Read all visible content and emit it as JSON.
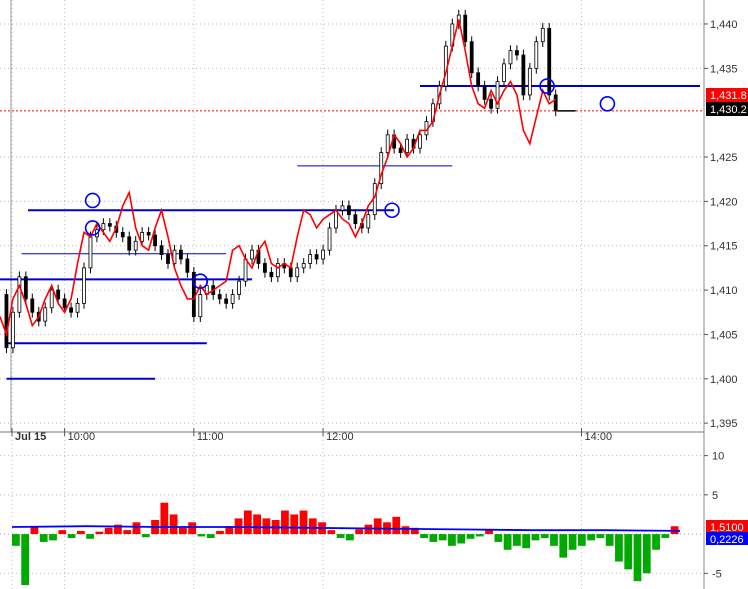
{
  "chart_data": [
    {
      "type": "candlestick",
      "title": "",
      "x_ticks": [
        {
          "label": "Jul 15",
          "time": "09:30"
        },
        {
          "label": "10:00",
          "time": "10:00"
        },
        {
          "label": "11:00",
          "time": "11:00"
        },
        {
          "label": "12:00",
          "time": "12:00"
        },
        {
          "label": "14:00",
          "time": "14:00"
        }
      ],
      "x_range": [
        "09:30",
        "14:55"
      ],
      "y_ticks": [
        "1,440",
        "1,435",
        "1,425",
        "1,420",
        "1,415",
        "1,410",
        "1,405",
        "1,400",
        "1,395"
      ],
      "ylim": [
        1394,
        1441.8
      ],
      "grid": true,
      "price_series": {
        "name": "",
        "points": [
          [
            "09:30",
            1409.5
          ],
          [
            "09:33",
            1403.5
          ],
          [
            "09:36",
            1407.5
          ],
          [
            "09:39",
            1411.5
          ],
          [
            "09:42",
            1409.0
          ],
          [
            "09:45",
            1407.5
          ],
          [
            "09:48",
            1406.5
          ],
          [
            "09:51",
            1408.0
          ],
          [
            "09:54",
            1410.0
          ],
          [
            "09:57",
            1409.0
          ],
          [
            "10:00",
            1408.0
          ],
          [
            "10:03",
            1407.5
          ],
          [
            "10:06",
            1408.5
          ],
          [
            "10:09",
            1412.5
          ],
          [
            "10:12",
            1416.0
          ],
          [
            "10:15",
            1416.8
          ],
          [
            "10:18",
            1417.5
          ],
          [
            "10:21",
            1417.2
          ],
          [
            "10:24",
            1416.5
          ],
          [
            "10:27",
            1416.0
          ],
          [
            "10:30",
            1414.5
          ],
          [
            "10:33",
            1415.5
          ],
          [
            "10:36",
            1416.5
          ],
          [
            "10:39",
            1416.2
          ],
          [
            "10:42",
            1415.0
          ],
          [
            "10:45",
            1414.0
          ],
          [
            "10:48",
            1413.0
          ],
          [
            "10:51",
            1414.5
          ],
          [
            "10:54",
            1413.5
          ],
          [
            "10:57",
            1412.0
          ],
          [
            "11:00",
            1407.0
          ],
          [
            "11:03",
            1409.5
          ],
          [
            "11:06",
            1410.5
          ],
          [
            "11:09",
            1409.5
          ],
          [
            "11:12",
            1409.0
          ],
          [
            "11:15",
            1408.5
          ],
          [
            "11:18",
            1409.5
          ],
          [
            "11:21",
            1411.0
          ],
          [
            "11:24",
            1413.5
          ],
          [
            "11:27",
            1414.5
          ],
          [
            "11:30",
            1413.0
          ],
          [
            "11:33",
            1412.0
          ],
          [
            "11:36",
            1411.5
          ],
          [
            "11:39",
            1413.0
          ],
          [
            "11:42",
            1412.5
          ],
          [
            "11:45",
            1411.5
          ],
          [
            "11:48",
            1412.5
          ],
          [
            "11:51",
            1413.0
          ],
          [
            "11:54",
            1414.0
          ],
          [
            "11:57",
            1413.5
          ],
          [
            "12:00",
            1414.5
          ],
          [
            "12:03",
            1417.0
          ],
          [
            "12:06",
            1419.0
          ],
          [
            "12:09",
            1419.5
          ],
          [
            "12:12",
            1418.5
          ],
          [
            "12:15",
            1417.5
          ],
          [
            "12:18",
            1417.0
          ],
          [
            "12:21",
            1418.5
          ],
          [
            "12:24",
            1422.0
          ],
          [
            "12:27",
            1425.5
          ],
          [
            "12:30",
            1427.5
          ],
          [
            "12:33",
            1426.0
          ],
          [
            "12:36",
            1425.5
          ],
          [
            "12:39",
            1427.0
          ],
          [
            "12:42",
            1426.0
          ],
          [
            "12:45",
            1427.5
          ],
          [
            "12:48",
            1429.0
          ],
          [
            "12:51",
            1431.0
          ],
          [
            "12:54",
            1433.0
          ],
          [
            "12:57",
            1437.5
          ],
          [
            "13:00",
            1440.0
          ],
          [
            "13:03",
            1441.0
          ],
          [
            "13:06",
            1438.0
          ],
          [
            "13:09",
            1434.5
          ],
          [
            "13:12",
            1433.0
          ],
          [
            "13:15",
            1431.5
          ],
          [
            "13:18",
            1430.5
          ],
          [
            "13:21",
            1433.5
          ],
          [
            "13:24",
            1435.5
          ],
          [
            "13:27",
            1437.0
          ],
          [
            "13:30",
            1436.5
          ],
          [
            "13:33",
            1432.0
          ],
          [
            "13:36",
            1435.0
          ],
          [
            "13:39",
            1438.0
          ],
          [
            "13:42",
            1439.5
          ],
          [
            "13:45",
            1432.0
          ],
          [
            "13:48",
            1430.2
          ]
        ]
      },
      "overlay_series": {
        "name": "",
        "color": "#ff0000",
        "points": [
          [
            "09:30",
            1407.0
          ],
          [
            "09:33",
            1405.0
          ],
          [
            "09:36",
            1409.0
          ],
          [
            "09:39",
            1410.5
          ],
          [
            "09:42",
            1408.5
          ],
          [
            "09:45",
            1406.0
          ],
          [
            "09:48",
            1407.0
          ],
          [
            "09:51",
            1409.0
          ],
          [
            "09:54",
            1410.5
          ],
          [
            "09:57",
            1408.5
          ],
          [
            "10:00",
            1407.5
          ],
          [
            "10:03",
            1409.0
          ],
          [
            "10:06",
            1413.0
          ],
          [
            "10:09",
            1416.5
          ],
          [
            "10:12",
            1416.0
          ],
          [
            "10:15",
            1417.5
          ],
          [
            "10:18",
            1416.5
          ],
          [
            "10:21",
            1415.5
          ],
          [
            "10:24",
            1417.0
          ],
          [
            "10:27",
            1419.5
          ],
          [
            "10:30",
            1421.0
          ],
          [
            "10:33",
            1417.0
          ],
          [
            "10:36",
            1415.0
          ],
          [
            "10:39",
            1414.5
          ],
          [
            "10:42",
            1417.0
          ],
          [
            "10:45",
            1419.0
          ],
          [
            "10:48",
            1416.0
          ],
          [
            "10:51",
            1412.5
          ],
          [
            "10:54",
            1410.5
          ],
          [
            "10:57",
            1409.0
          ],
          [
            "11:00",
            1409.0
          ],
          [
            "11:03",
            1410.5
          ],
          [
            "11:06",
            1409.5
          ],
          [
            "11:09",
            1410.0
          ],
          [
            "11:12",
            1410.5
          ],
          [
            "11:15",
            1411.0
          ],
          [
            "11:18",
            1414.5
          ],
          [
            "11:21",
            1415.0
          ],
          [
            "11:24",
            1413.5
          ],
          [
            "11:27",
            1412.5
          ],
          [
            "11:30",
            1414.5
          ],
          [
            "11:33",
            1415.5
          ],
          [
            "11:36",
            1413.0
          ],
          [
            "11:39",
            1412.5
          ],
          [
            "11:42",
            1413.0
          ],
          [
            "11:45",
            1412.5
          ],
          [
            "11:48",
            1416.0
          ],
          [
            "11:51",
            1419.0
          ],
          [
            "11:54",
            1418.5
          ],
          [
            "11:57",
            1417.0
          ],
          [
            "12:00",
            1418.0
          ],
          [
            "12:03",
            1418.5
          ],
          [
            "12:06",
            1419.0
          ],
          [
            "12:09",
            1418.0
          ],
          [
            "12:12",
            1417.5
          ],
          [
            "12:15",
            1416.0
          ],
          [
            "12:18",
            1417.5
          ],
          [
            "12:21",
            1419.5
          ],
          [
            "12:24",
            1420.5
          ],
          [
            "12:27",
            1423.0
          ],
          [
            "12:30",
            1425.0
          ],
          [
            "12:33",
            1427.5
          ],
          [
            "12:36",
            1426.5
          ],
          [
            "12:39",
            1425.0
          ],
          [
            "12:42",
            1426.0
          ],
          [
            "12:45",
            1428.0
          ],
          [
            "12:48",
            1428.0
          ],
          [
            "12:51",
            1429.0
          ],
          [
            "12:54",
            1432.0
          ],
          [
            "12:57",
            1434.5
          ],
          [
            "13:00",
            1437.5
          ],
          [
            "13:03",
            1440.5
          ],
          [
            "13:06",
            1437.0
          ],
          [
            "13:09",
            1433.0
          ],
          [
            "13:12",
            1431.0
          ],
          [
            "13:15",
            1430.5
          ],
          [
            "13:18",
            1432.5
          ],
          [
            "13:21",
            1431.0
          ],
          [
            "13:24",
            1432.5
          ],
          [
            "13:27",
            1433.5
          ],
          [
            "13:30",
            1432.0
          ],
          [
            "13:33",
            1428.0
          ],
          [
            "13:36",
            1426.5
          ],
          [
            "13:39",
            1429.5
          ],
          [
            "13:42",
            1432.5
          ],
          [
            "13:45",
            1431.0
          ],
          [
            "13:48",
            1431.5
          ]
        ]
      },
      "support_resistance_lines": [
        {
          "price": 1400.0,
          "from": "09:33",
          "to": "10:42",
          "thick": true
        },
        {
          "price": 1404.0,
          "from": "09:33",
          "to": "11:06",
          "thick": true
        },
        {
          "price": 1411.2,
          "from": "09:30",
          "to": "11:27",
          "thick": true
        },
        {
          "price": 1414.1,
          "from": "09:40",
          "to": "11:15",
          "thick": false
        },
        {
          "price": 1419.0,
          "from": "09:43",
          "to": "12:33",
          "thick": true
        },
        {
          "price": 1424.0,
          "from": "11:48",
          "to": "13:00",
          "thick": false
        },
        {
          "price": 1433.0,
          "from": "12:45",
          "to": "14:55",
          "thick": true
        }
      ],
      "circle_markers": [
        {
          "time": "10:13",
          "price": 1420.1
        },
        {
          "time": "10:13",
          "price": 1417.0
        },
        {
          "time": "11:03",
          "price": 1411.0
        },
        {
          "time": "12:32",
          "price": 1419.0
        },
        {
          "time": "13:44",
          "price": 1433.0
        },
        {
          "time": "14:12",
          "price": 1431.0
        }
      ],
      "current_price_labels": [
        {
          "text": "1,431.8",
          "color": "#ff0000"
        },
        {
          "text": "1,430.2",
          "color": "#000000"
        }
      ],
      "reference_line": {
        "price": 1430.2,
        "style": "dotted",
        "color": "#ff0000"
      }
    },
    {
      "type": "bar",
      "title": "",
      "y_ticks": [
        "10",
        "5",
        "-5"
      ],
      "ylim": [
        -7,
        12.5
      ],
      "grid": true,
      "series": [
        {
          "name": "",
          "positive_color": "#ff0000",
          "negative_color": "#00aa00",
          "values": [
            -1.5,
            -6.5,
            1.0,
            -1.0,
            -0.8,
            0.5,
            -0.5,
            0.4,
            -0.6,
            0.3,
            0.8,
            1.2,
            0.5,
            1.5,
            -0.4,
            1.8,
            4.0,
            2.5,
            0.8,
            1.5,
            -0.3,
            -0.5,
            0.4,
            1.0,
            2.0,
            3.0,
            2.5,
            2.0,
            1.8,
            3.0,
            2.5,
            3.0,
            2.0,
            1.5,
            0.5,
            -0.5,
            -0.8,
            0.6,
            1.2,
            2.0,
            1.5,
            2.2,
            1.0,
            0.8,
            -0.5,
            -1.0,
            -0.8,
            -1.5,
            -1.2,
            -0.6,
            -0.3,
            0.5,
            -1.0,
            -2.0,
            -1.5,
            -1.8,
            -0.8,
            -0.5,
            -1.5,
            -3.0,
            -2.0,
            -1.5,
            -0.8,
            -0.5,
            -1.5,
            -3.5,
            -4.5,
            -6.0,
            -5.0,
            -2.0,
            -0.5,
            1.0
          ]
        },
        {
          "name": "",
          "color": "#0000ff",
          "type": "line",
          "values": [
            0.9,
            1.0,
            0.9,
            0.9,
            0.8,
            0.7,
            0.6,
            0.5,
            0.5,
            0.4
          ]
        }
      ],
      "current_value_labels": [
        {
          "text": "1,5100",
          "color": "#ff0000"
        },
        {
          "text": "0,2226",
          "color": "#0000ff"
        }
      ]
    }
  ]
}
